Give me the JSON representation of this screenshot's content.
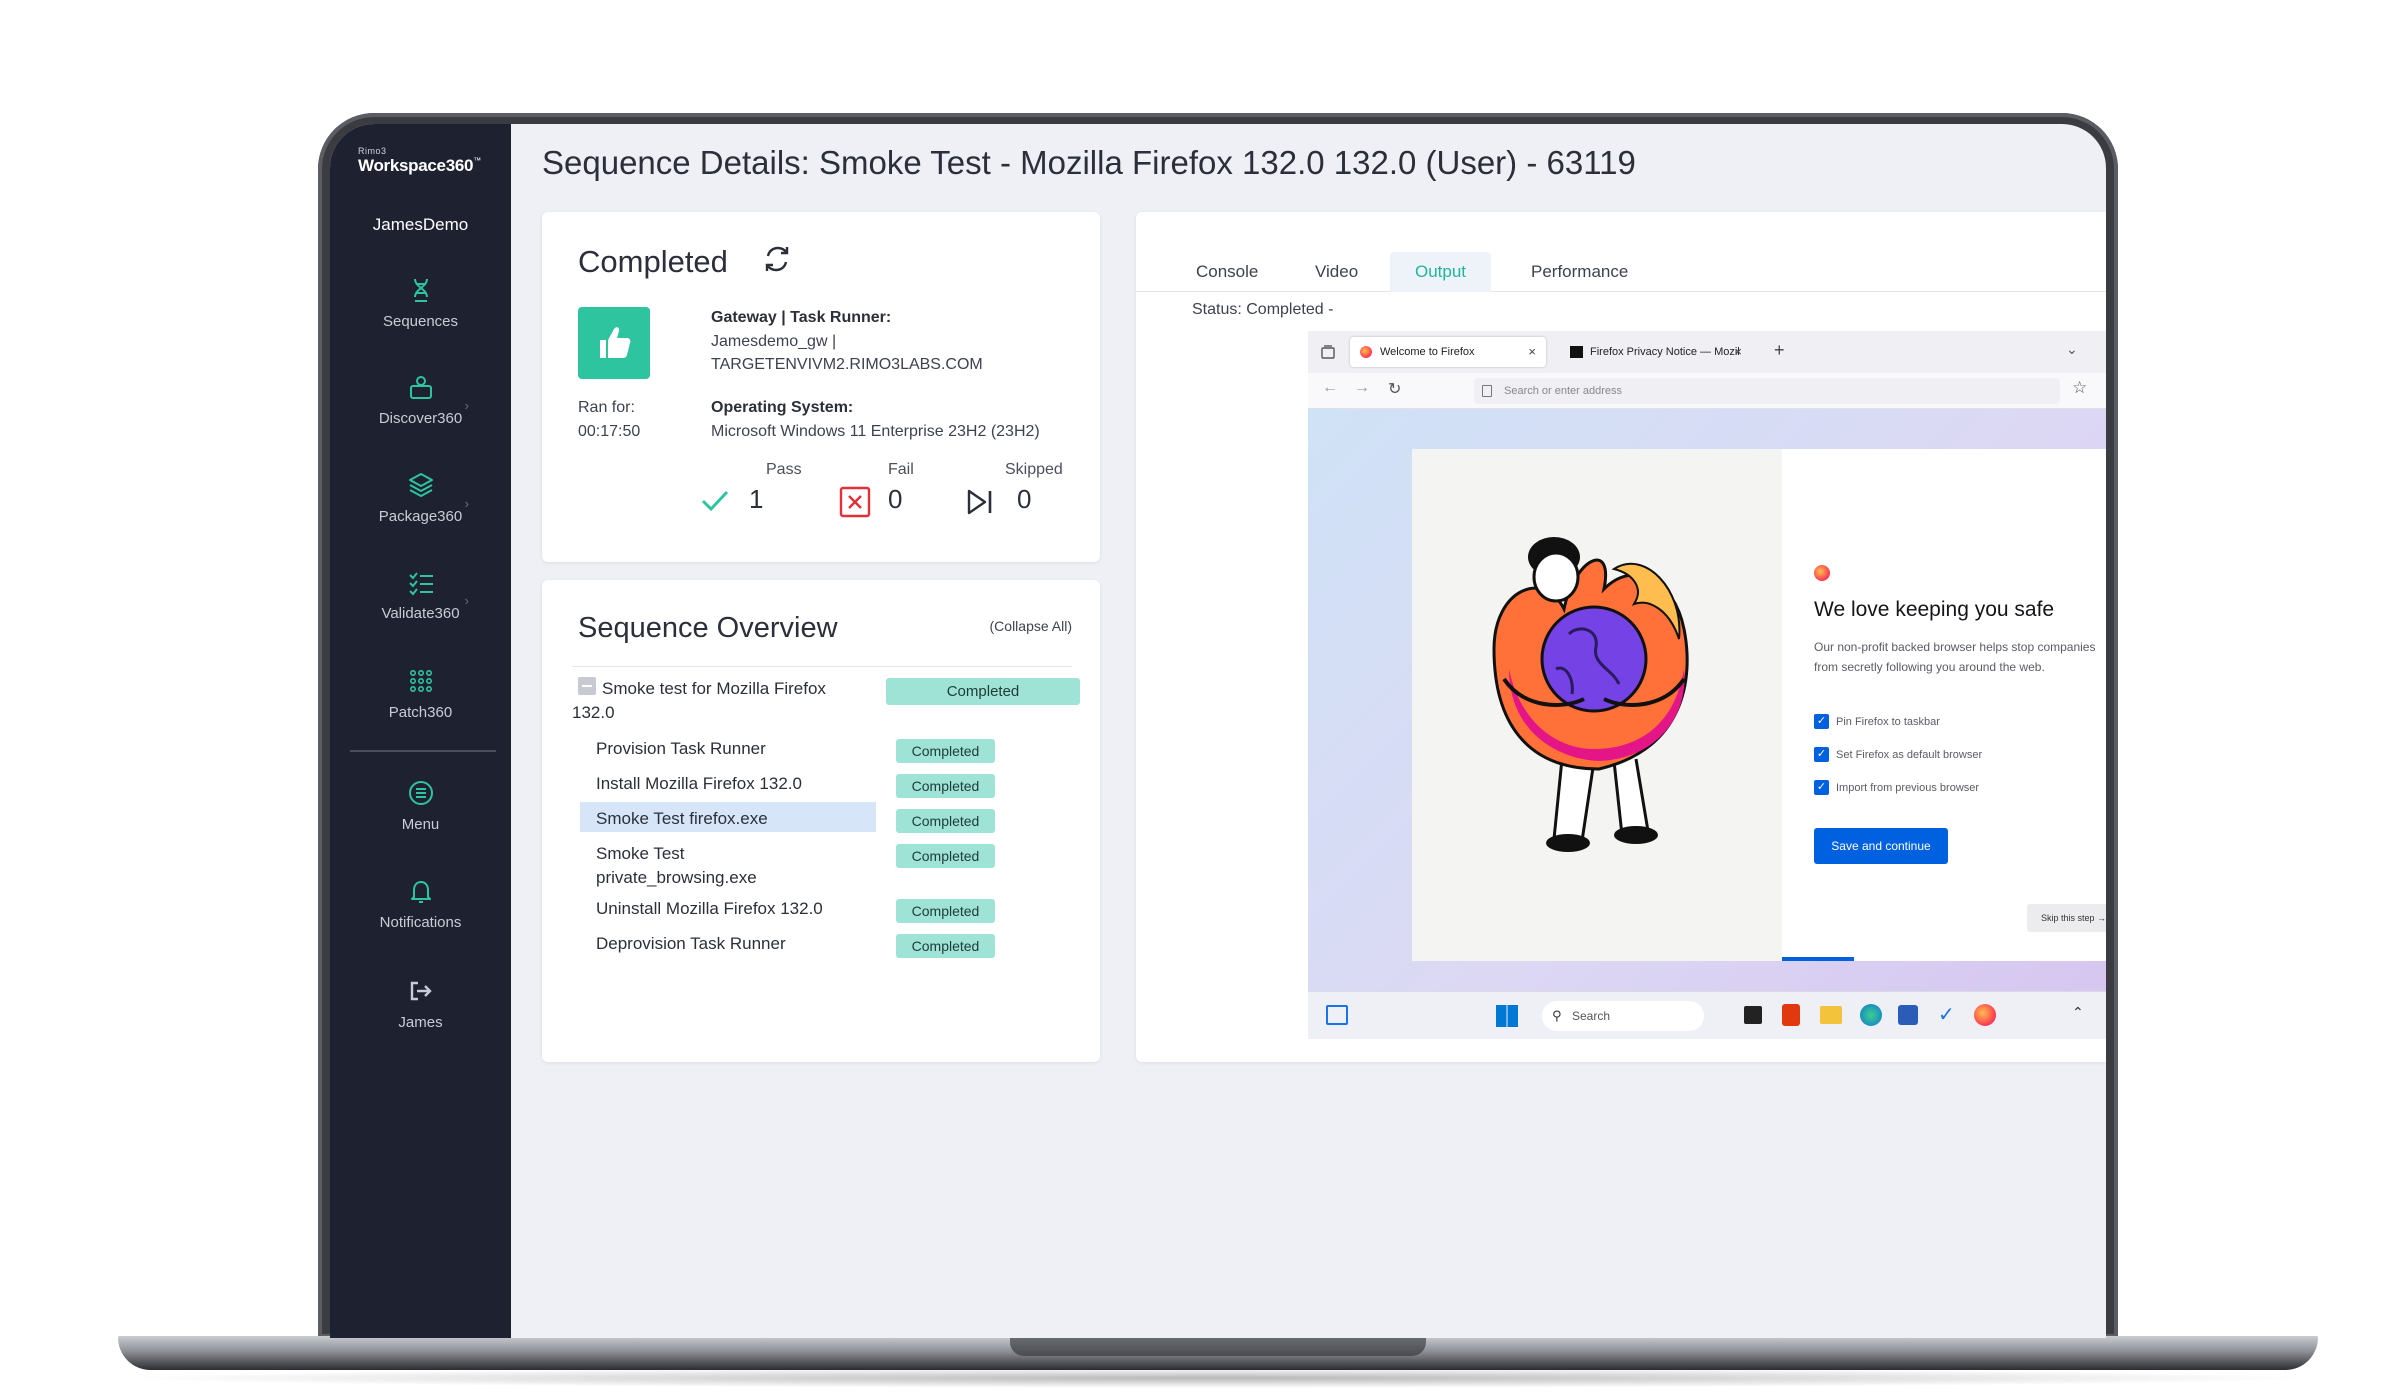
{
  "brand": {
    "small": "Rimo3",
    "main": "Workspace360",
    "tm": "™"
  },
  "sidebar": {
    "org": "JamesDemo",
    "items": [
      {
        "label": "Sequences",
        "icon": "dna-icon"
      },
      {
        "label": "Discover360",
        "icon": "discover-icon"
      },
      {
        "label": "Package360",
        "icon": "layers-icon"
      },
      {
        "label": "Validate360",
        "icon": "checklist-icon"
      },
      {
        "label": "Patch360",
        "icon": "grid-dots-icon"
      },
      {
        "label": "Menu",
        "icon": "menu-icon"
      },
      {
        "label": "Notifications",
        "icon": "bell-icon"
      },
      {
        "label": "James",
        "icon": "logout-icon"
      }
    ]
  },
  "page": {
    "title": "Sequence Details: Smoke Test - Mozilla Firefox 132.0 132.0 (User) - 63119"
  },
  "status_card": {
    "heading": "Completed",
    "ran_for_label": "Ran for:",
    "ran_for_value": "00:17:50",
    "gateway_label": "Gateway | Task Runner:",
    "gateway_value_1": "Jamesdemo_gw |",
    "gateway_value_2": "TARGETENVIVM2.RIMO3LABS.COM",
    "os_label": "Operating System:",
    "os_value": "Microsoft Windows 11 Enterprise 23H2 (23H2)",
    "pass_label": "Pass",
    "pass_value": "1",
    "fail_label": "Fail",
    "fail_value": "0",
    "skipped_label": "Skipped",
    "skipped_value": "0",
    "accent_color": "#2ec4a0"
  },
  "overview": {
    "heading": "Sequence Overview",
    "collapse_label": "(Collapse All)",
    "root": {
      "label": "Smoke test for Mozilla Firefox 132.0",
      "status": "Completed"
    },
    "steps": [
      {
        "label": "Provision Task Runner",
        "status": "Completed"
      },
      {
        "label": "Install Mozilla Firefox 132.0",
        "status": "Completed"
      },
      {
        "label": "Smoke Test firefox.exe",
        "status": "Completed"
      },
      {
        "label": "Smoke Test private_browsing.exe",
        "status": "Completed"
      },
      {
        "label": "Uninstall Mozilla Firefox 132.0",
        "status": "Completed"
      },
      {
        "label": "Deprovision Task Runner",
        "status": "Completed"
      }
    ]
  },
  "output": {
    "tabs": [
      "Console",
      "Video",
      "Output",
      "Performance"
    ],
    "active_tab": "Output",
    "status_line": "Status: Completed -",
    "firefox": {
      "tab1": "Welcome to Firefox",
      "tab2": "Firefox Privacy Notice — Mozil",
      "url_placeholder": "Search or enter address",
      "dialog_heading": "We love keeping you safe",
      "dialog_text": "Our non-profit backed browser helps stop companies from secretly following you around the web.",
      "checks": [
        "Pin Firefox to taskbar",
        "Set Firefox as default browser",
        "Import from previous browser"
      ],
      "save_button": "Save and continue",
      "skip_button": "Skip this step →"
    },
    "taskbar_search": "Search"
  }
}
